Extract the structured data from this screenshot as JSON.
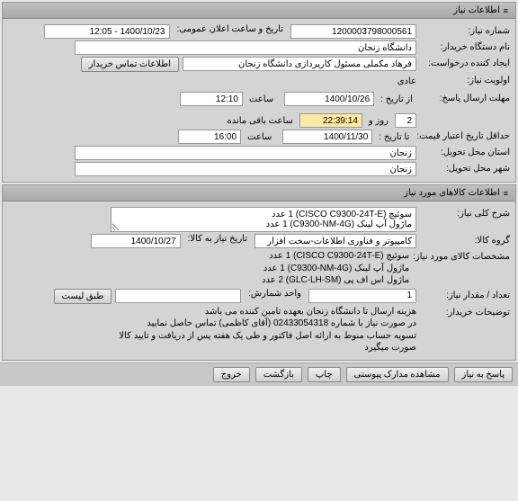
{
  "panels": {
    "need_info": {
      "title": "اطلاعات نیاز"
    },
    "goods_info": {
      "title": "اطلاعات کالاهای مورد نیاز"
    }
  },
  "need": {
    "number_label": "شماره نیاز:",
    "number": "1200003798000561",
    "announce_label": "تاریخ و ساعت اعلان عمومی:",
    "announce_value": "1400/10/23 - 12:05",
    "buyer_label": "نام دستگاه خریدار:",
    "buyer": "دانشگاه زنجان",
    "creator_label": "ایجاد کننده درخواست:",
    "creator": "فرهاد مکملی مسئول کارپردازی دانشگاه زنجان",
    "buyer_contact_btn": "اطلاعات تماس خریدار",
    "priority_label": "اولویت نیاز:",
    "priority": "عادی",
    "reply_deadline_label": "مهلت ارسال پاسخ:",
    "from_date_label": "از تاریخ :",
    "reply_date": "1400/10/26",
    "hour_label": "ساعت",
    "reply_time": "12:10",
    "days_remain": "2",
    "days_remain_label": "روز و",
    "time_remain": "22:39:14",
    "time_remain_label": "ساعت باقی مانده",
    "price_validity_label": "حداقل تاریخ اعتبار قیمت:",
    "to_date_label": "تا تاریخ :",
    "validity_date": "1400/11/30",
    "validity_time": "16:00",
    "delivery_province_label": "استان محل تحویل:",
    "delivery_province": "زنجان",
    "delivery_city_label": "شهر محل تحویل:",
    "delivery_city": "زنجان"
  },
  "goods": {
    "desc_label": "شرح کلی نیاز:",
    "desc_line1": "سوئیچ (CISCO C9300-24T-E) 1 عدد",
    "desc_line2": "ماژول آپ لینک (C9300-NM-4G) 1 عدد",
    "group_label": "گروه کالا:",
    "group": "کامپیوتر و فناوری اطلاعات-سخت افزار",
    "need_date_label": "تاریخ نیاز به کالا:",
    "need_date": "1400/10/27",
    "spec_label": "مشخصات کالای مورد نیاز:",
    "spec_line1": "سوئیچ (CISCO C9300-24T-E) 1 عدد",
    "spec_line2": "ماژول آپ لینک (C9300-NM-4G) 1 عدد",
    "spec_line3": "ماژول اس اف پی (GLC-LH-SM) 2 عدد",
    "qty_label": "تعداد / مقدار نیاز:",
    "qty": "1",
    "unit_label": "واحد شمارش:",
    "unit_btn": "طبق لیست",
    "notes_label": "توضیحات خریدار:",
    "notes_line1": "هزینه ارسال تا دانشگاه زنجان بعهده تامین کننده می باشد",
    "notes_line2": "در صورت نیاز با شماره 02433054318 (آقای کاظمی) تماس حاصل نمایید",
    "notes_line3": "تسویه حساب منوط به ارائه اصل فاکتور و طی یک هفته پس از دریافت و تایید کالا صورت میگیرد"
  },
  "buttons": {
    "reply": "پاسخ به نیاز",
    "attachments": "مشاهده مدارک پیوستی",
    "print": "چاپ",
    "back": "بازگشت",
    "exit": "خروج"
  },
  "icons": {
    "collapse": "≡"
  }
}
